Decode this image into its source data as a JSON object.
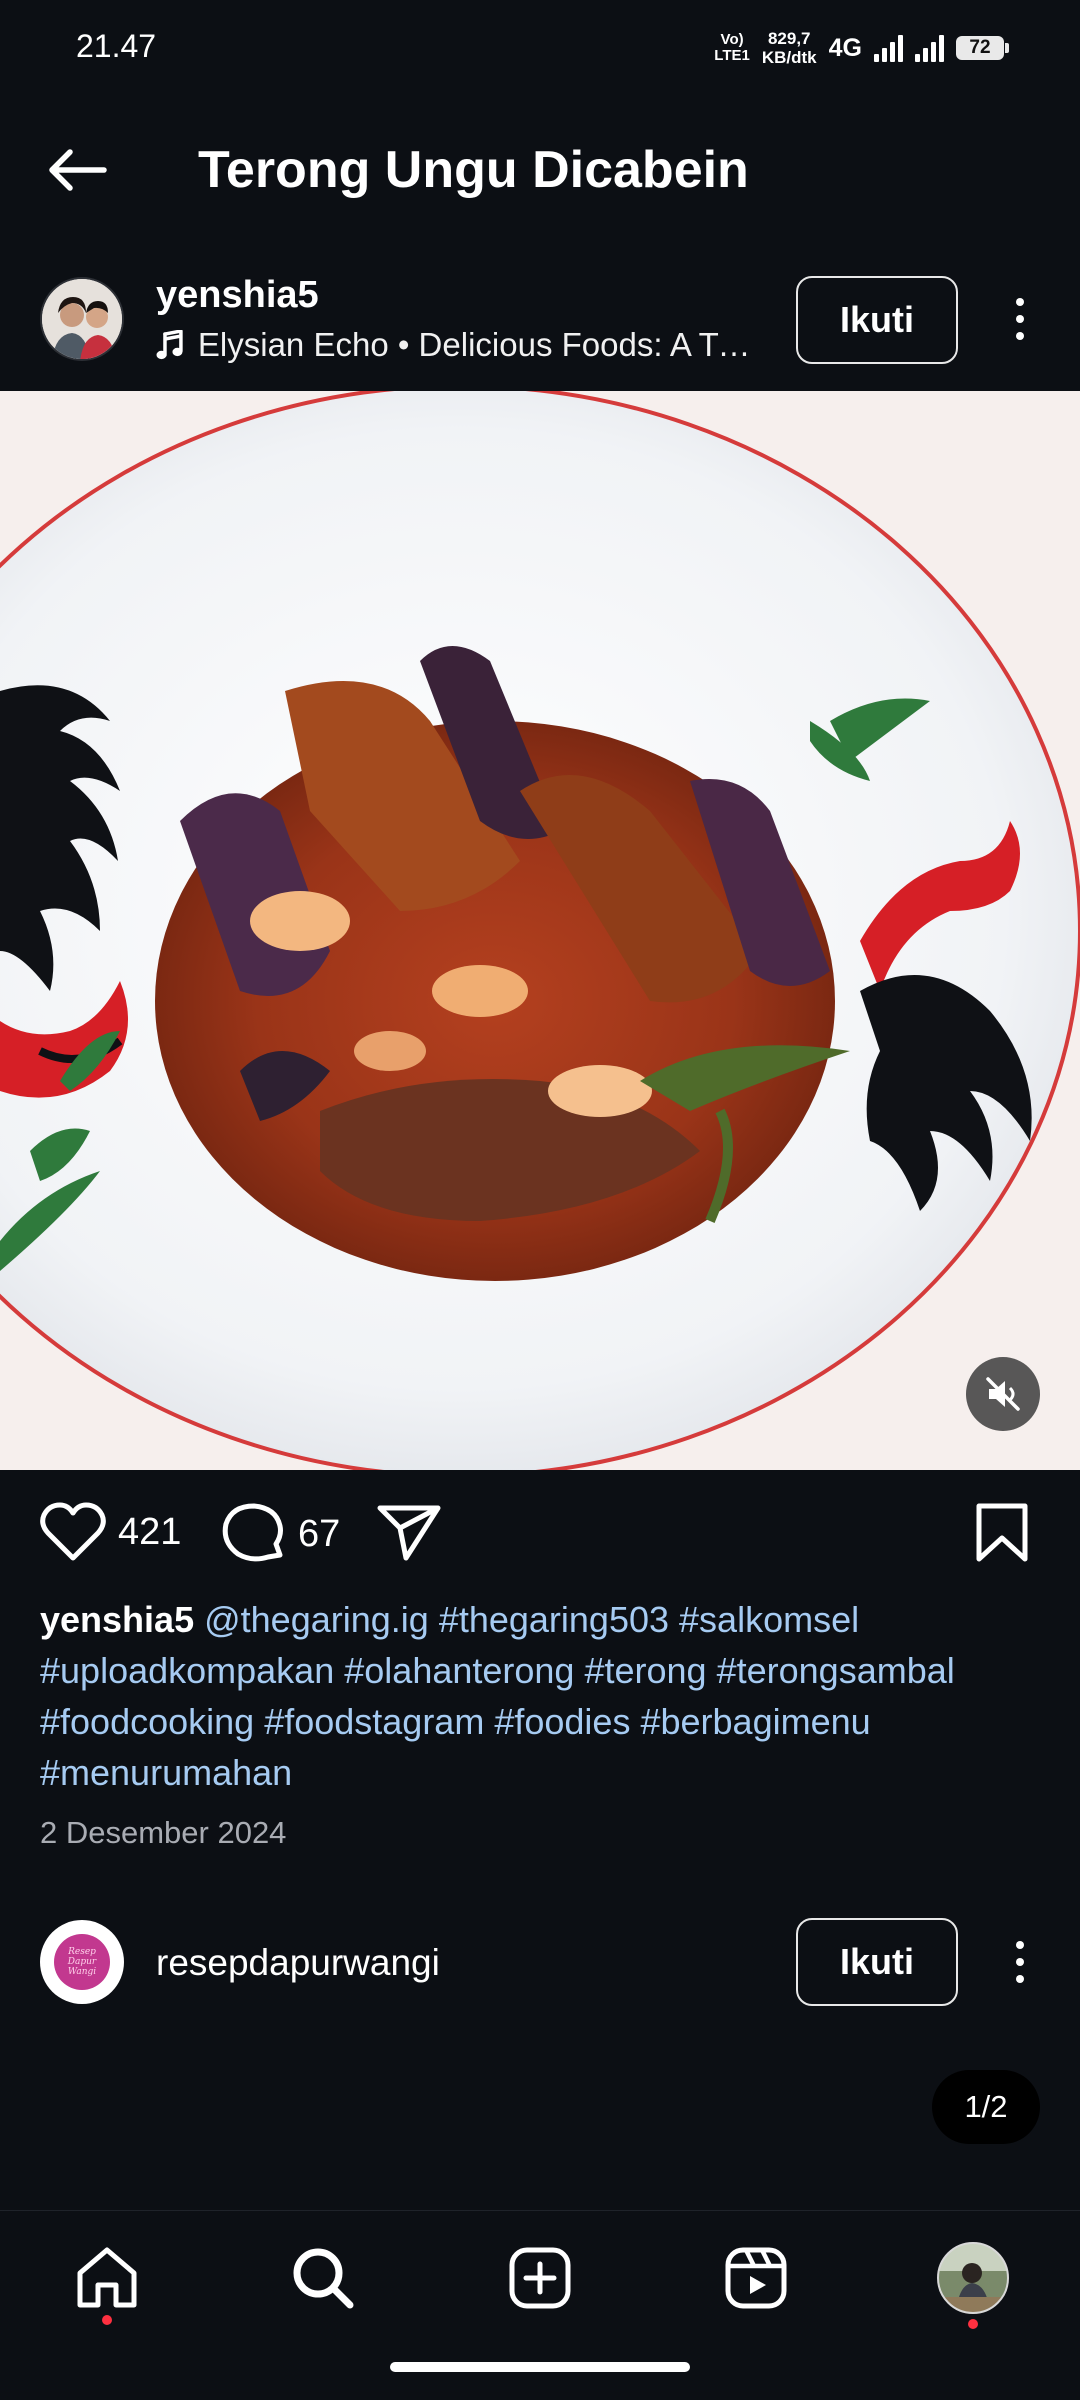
{
  "status_bar": {
    "time": "21.47",
    "volte_top": "Vo)",
    "volte_bottom": "LTE1",
    "speed_top": "829,7",
    "speed_bottom": "KB/dtk",
    "network": "4G",
    "battery": "72"
  },
  "header": {
    "title": "Terong Ungu Dicabein",
    "back_icon": "arrow-left-icon"
  },
  "post": {
    "username": "yenshia5",
    "music": "Elysian Echo • Delicious Foods: A Tri…",
    "follow_label": "Ikuti",
    "likes": "421",
    "comments": "67",
    "caption_user": "yenshia5",
    "caption_tags": [
      "@thegaring.ig",
      "#thegaring503",
      "#salkomsel",
      "#uploadkompakan",
      "#olahanterong",
      "#terong",
      "#terongsambal",
      "#foodcooking",
      "#foodstagram",
      "#foodies",
      "#berbagimenu",
      "#menurumahan"
    ],
    "date": "2 Desember 2024"
  },
  "suggested": {
    "username": "resepdapurwangi",
    "avatar_text": "Resep Dapur Wangi",
    "follow_label": "Ikuti"
  },
  "carousel": {
    "indicator": "1/2"
  },
  "nav": {
    "items": [
      "home-icon",
      "search-icon",
      "create-icon",
      "reels-icon",
      "profile-avatar"
    ]
  },
  "colors": {
    "background": "#0c0f14",
    "hashtag": "#a6cbf2",
    "notification_dot": "#ff3040"
  }
}
